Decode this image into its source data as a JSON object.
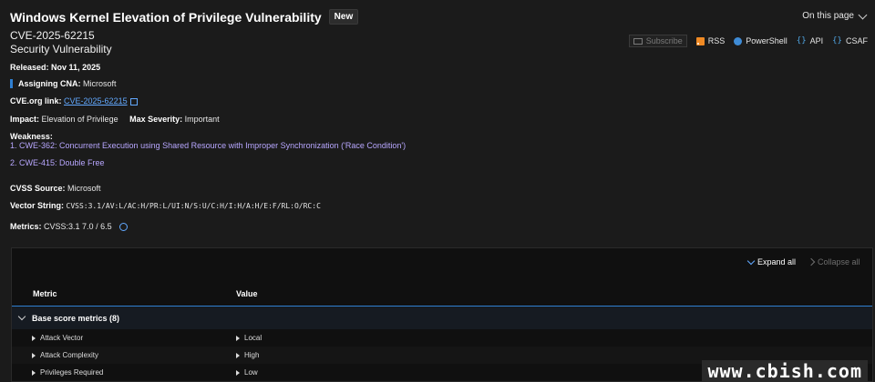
{
  "header": {
    "title": "Windows Kernel Elevation of Privilege Vulnerability",
    "badge": "New",
    "on_this_page": "On this page"
  },
  "cve": {
    "id": "CVE-2025-62215",
    "type": "Security Vulnerability"
  },
  "feeds": {
    "subscribe": "Subscribe",
    "rss": "RSS",
    "powershell": "PowerShell",
    "api": "API",
    "csaf": "CSAF"
  },
  "details": {
    "released_label": "Released:",
    "released_value": "Nov 11, 2025",
    "cna_label": "Assigning CNA:",
    "cna_value": "Microsoft",
    "cveorg_label": "CVE.org link:",
    "cveorg_value": "CVE-2025-62215",
    "impact_label": "Impact:",
    "impact_value": "Elevation of Privilege",
    "severity_label": "Max Severity:",
    "severity_value": "Important",
    "weakness_label": "Weakness:",
    "weaknesses": [
      "1. CWE-362: Concurrent Execution using Shared Resource with Improper Synchronization ('Race Condition')",
      "2. CWE-415: Double Free"
    ],
    "cvss_source_label": "CVSS Source:",
    "cvss_source_value": "Microsoft",
    "vector_label": "Vector String:",
    "vector_value": "CVSS:3.1/AV:L/AC:H/PR:L/UI:N/S:U/C:H/I:H/A:H/E:F/RL:O/RC:C",
    "metrics_label": "Metrics:",
    "metrics_value": "CVSS:3.1 7.0 / 6.5"
  },
  "panel": {
    "expand_all": "Expand all",
    "collapse_all": "Collapse all",
    "col_metric": "Metric",
    "col_value": "Value",
    "group_label": "Base score metrics (8)",
    "rows": [
      {
        "metric": "Attack Vector",
        "value": "Local"
      },
      {
        "metric": "Attack Complexity",
        "value": "High"
      },
      {
        "metric": "Privileges Required",
        "value": "Low"
      }
    ]
  },
  "watermark": "www.cbish.com",
  "colors": {
    "background": "#1b1b1b",
    "accent_blue": "#2f7fd1",
    "link": "#62a9ff",
    "weakness_link": "#b8a7ff",
    "rss": "#f08a24"
  }
}
